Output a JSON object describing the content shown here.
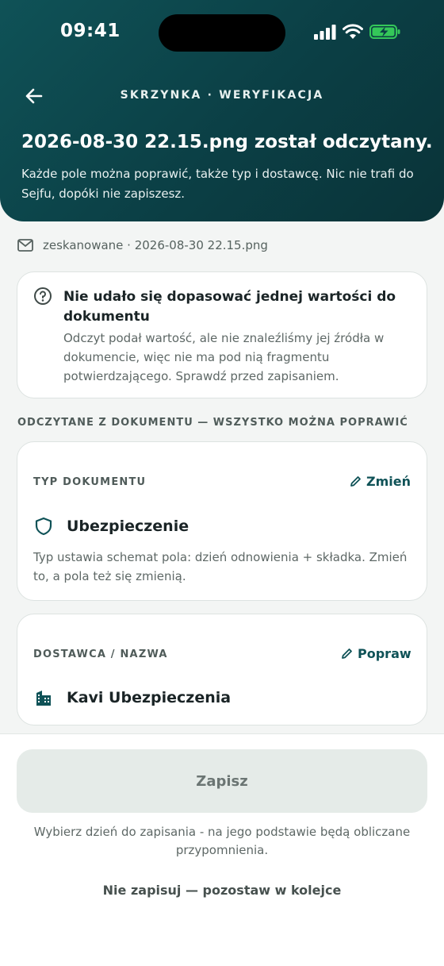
{
  "status_bar": {
    "time": "09:41"
  },
  "header": {
    "breadcrumb": "SKRZYNKA · WERYFIKACJA",
    "title": "2026-08-30 22.15.png został odczytany.",
    "subtitle": "Każde pole można poprawić, także typ i dostawcę. Nic nie trafi do Sejfu, dopóki nie zapiszesz."
  },
  "source": {
    "text": "zeskanowane · 2026-08-30 22.15.png",
    "icon": "mail-icon"
  },
  "warning": {
    "title": "Nie udało się dopasować jednej wartości do dokumentu",
    "text": "Odczyt podał wartość, ale nie znaleźliśmy jej źródła w dokumencie, więc nie ma pod nią fragmentu potwierdzającego. Sprawdź przed zapisaniem.",
    "icon": "question-circle-icon"
  },
  "section_label": "ODCZYTANE Z DOKUMENTU — WSZYSTKO MOŻNA POPRAWIĆ",
  "doc_type": {
    "label": "TYP DOKUMENTU",
    "action": "Zmień",
    "value": "Ubezpieczenie",
    "icon": "shield-icon",
    "help": "Typ ustawia schemat pola: dzień odnowienia + składka. Zmień to, a pola też się zmienią."
  },
  "provider": {
    "label": "DOSTAWCA / NAZWA",
    "action": "Popraw",
    "value": "Kavi Ubezpieczenia",
    "icon": "building-icon"
  },
  "footer": {
    "save_label": "Zapisz",
    "hint": "Wybierz dzień do zapisania - na jego podstawie będą obliczane przypomnienia.",
    "skip_label": "Nie zapisuj — pozostaw w kolejce"
  },
  "colors": {
    "accent": "#0f5257",
    "header_dark": "#0a3338",
    "battery_green": "#34c759"
  }
}
